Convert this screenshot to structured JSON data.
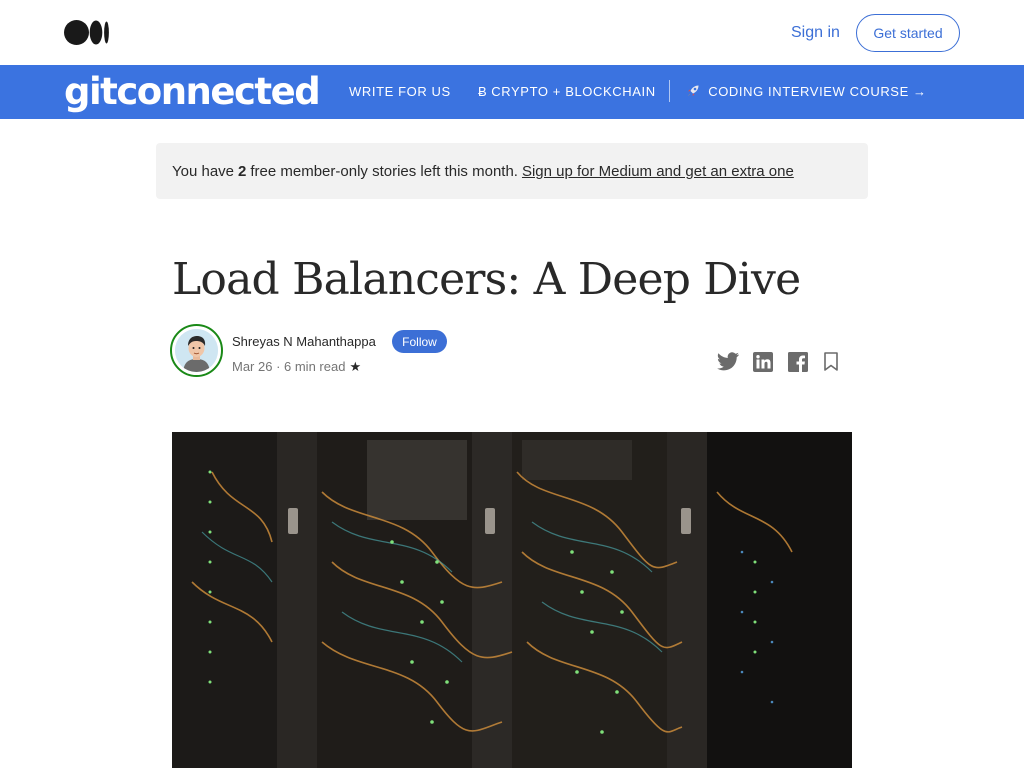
{
  "topbar": {
    "logo": "medium-logo",
    "signin_label": "Sign in",
    "getstarted_label": "Get started",
    "accent": "#3c6fd6"
  },
  "publication": {
    "name": "gitconnected",
    "color": "#3b73e0",
    "nav": [
      {
        "label": "WRITE FOR US",
        "icon": ""
      },
      {
        "label": "CRYPTO + BLOCKCHAIN",
        "icon": "bitcoin-icon",
        "glyph": "Ƀ"
      },
      {
        "label": "CODING INTERVIEW COURSE →",
        "icon": "rocket-icon",
        "glyph": "🚀"
      }
    ]
  },
  "banner": {
    "prefix": "You have",
    "count": "2",
    "suffix": "free member-only stories left this month.",
    "link": "Sign up for Medium and get an extra one"
  },
  "article": {
    "title": "Load Balancers: A Deep Dive",
    "author": "Shreyas N Mahanthappa",
    "follow_label": "Follow",
    "meta": "Mar 26 · 6 min read",
    "star": "★"
  },
  "share": [
    "twitter-icon",
    "linkedin-icon",
    "facebook-icon",
    "bookmark-icon"
  ],
  "hero": {
    "subject": "server-racks-photo"
  }
}
